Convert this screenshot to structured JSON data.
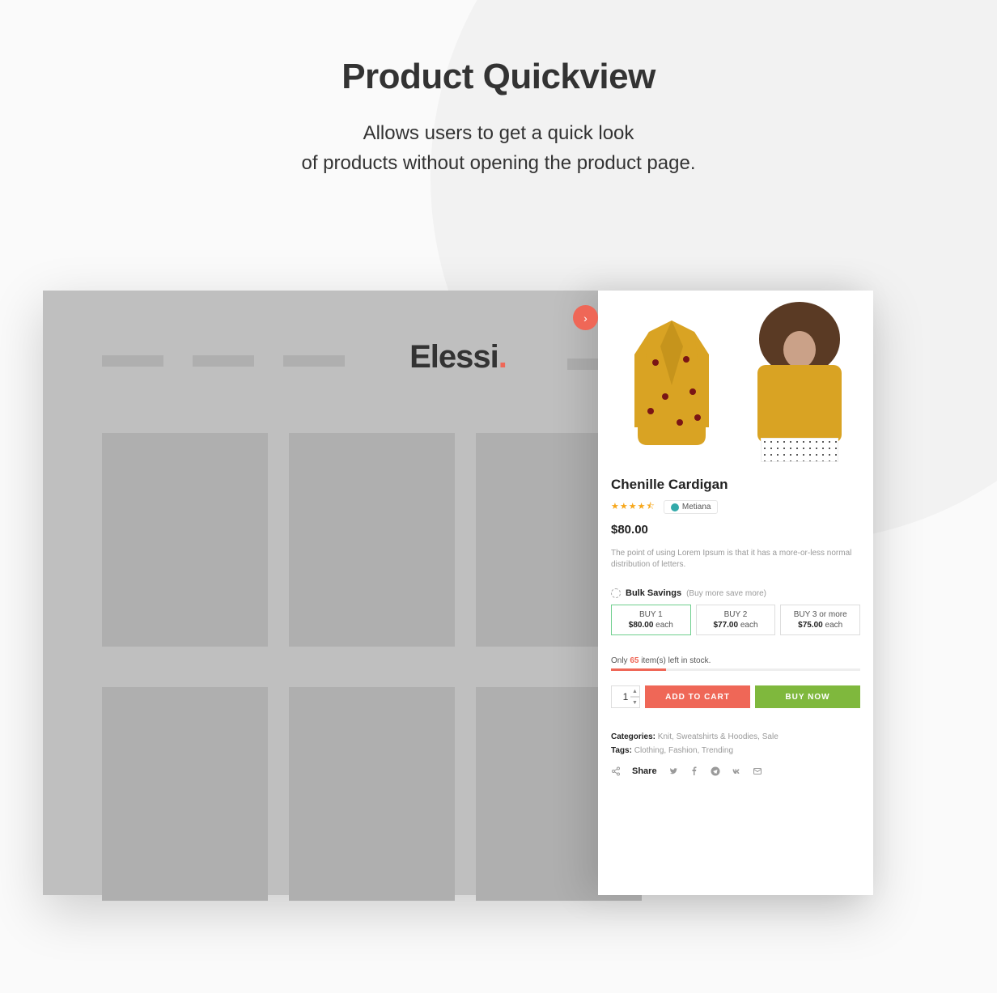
{
  "page": {
    "title": "Product Quickview",
    "subtitle_line1": "Allows users to get a quick look",
    "subtitle_line2": "of products without opening the product page."
  },
  "header": {
    "brand": "Elessi",
    "brand_dot": "."
  },
  "quickview": {
    "close_glyph": "›",
    "product_name": "Chenille Cardigan",
    "stars_glyph": "★★★★⯪",
    "vendor_name": "Metiana",
    "price": "$80.00",
    "description": "The point of using Lorem Ipsum is that it has a more-or-less normal distribution of letters.",
    "bulk": {
      "label": "Bulk Savings",
      "sub": "(Buy more save more)",
      "tiers": [
        {
          "line1": "BUY 1",
          "price": "$80.00",
          "suffix": " each",
          "selected": true
        },
        {
          "line1": "BUY 2",
          "price": "$77.00",
          "suffix": " each",
          "selected": false
        },
        {
          "line1": "BUY 3 or more",
          "price": "$75.00",
          "suffix": " each",
          "selected": false
        }
      ]
    },
    "stock": {
      "prefix": "Only ",
      "count": "65",
      "suffix": " item(s) left in stock."
    },
    "qty_value": "1",
    "add_to_cart_label": "ADD TO CART",
    "buy_now_label": "BUY NOW",
    "categories_label": "Categories:",
    "categories_value": " Knit, Sweatshirts & Hoodies, Sale",
    "tags_label": "Tags:",
    "tags_value": " Clothing, Fashion, Trending",
    "share_label": "Share"
  }
}
